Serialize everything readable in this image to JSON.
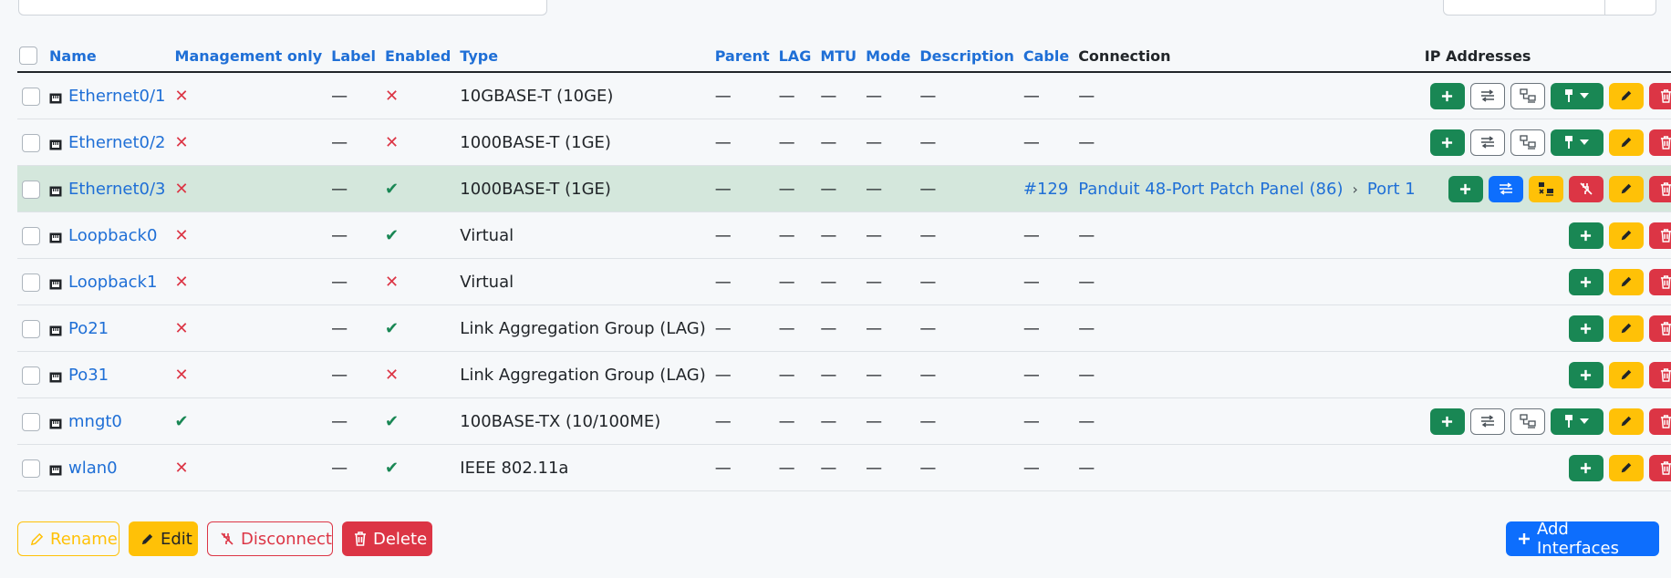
{
  "table": {
    "headers": {
      "name": "Name",
      "management_only": "Management only",
      "label": "Label",
      "enabled": "Enabled",
      "type": "Type",
      "parent": "Parent",
      "lag": "LAG",
      "mtu": "MTU",
      "mode": "Mode",
      "description": "Description",
      "cable": "Cable",
      "connection": "Connection",
      "ip_addresses": "IP Addresses"
    },
    "rows": [
      {
        "name": "Ethernet0/1",
        "mgmt": "✕",
        "label": "—",
        "enabled": "✕",
        "type": "10GBASE-T (10GE)",
        "parent": "—",
        "lag": "—",
        "mtu": "—",
        "mode": "—",
        "description": "—",
        "cable": "—",
        "connection": "—"
      },
      {
        "name": "Ethernet0/2",
        "mgmt": "✕",
        "label": "—",
        "enabled": "✕",
        "type": "1000BASE-T (1GE)",
        "parent": "—",
        "lag": "—",
        "mtu": "—",
        "mode": "—",
        "description": "—",
        "cable": "—",
        "connection": "—"
      },
      {
        "name": "Ethernet0/3",
        "mgmt": "✕",
        "label": "—",
        "enabled": "✔",
        "type": "1000BASE-T (1GE)",
        "parent": "—",
        "lag": "—",
        "mtu": "—",
        "mode": "—",
        "description": "—",
        "cable": "#129",
        "connection_device": "Panduit 48-Port Patch Panel (86)",
        "connection_port": "Port 1"
      },
      {
        "name": "Loopback0",
        "mgmt": "✕",
        "label": "—",
        "enabled": "✔",
        "type": "Virtual",
        "parent": "—",
        "lag": "—",
        "mtu": "—",
        "mode": "—",
        "description": "—",
        "cable": "—",
        "connection": "—"
      },
      {
        "name": "Loopback1",
        "mgmt": "✕",
        "label": "—",
        "enabled": "✕",
        "type": "Virtual",
        "parent": "—",
        "lag": "—",
        "mtu": "—",
        "mode": "—",
        "description": "—",
        "cable": "—",
        "connection": "—"
      },
      {
        "name": "Po21",
        "mgmt": "✕",
        "label": "—",
        "enabled": "✔",
        "type": "Link Aggregation Group (LAG)",
        "parent": "—",
        "lag": "—",
        "mtu": "—",
        "mode": "—",
        "description": "—",
        "cable": "—",
        "connection": "—"
      },
      {
        "name": "Po31",
        "mgmt": "✕",
        "label": "—",
        "enabled": "✕",
        "type": "Link Aggregation Group (LAG)",
        "parent": "—",
        "lag": "—",
        "mtu": "—",
        "mode": "—",
        "description": "—",
        "cable": "—",
        "connection": "—"
      },
      {
        "name": "mngt0",
        "mgmt": "✔",
        "label": "—",
        "enabled": "✔",
        "type": "100BASE-TX (10/100ME)",
        "parent": "—",
        "lag": "—",
        "mtu": "—",
        "mode": "—",
        "description": "—",
        "cable": "—",
        "connection": "—"
      },
      {
        "name": "wlan0",
        "mgmt": "✕",
        "label": "—",
        "enabled": "✔",
        "type": "IEEE 802.11a",
        "parent": "—",
        "lag": "—",
        "mtu": "—",
        "mode": "—",
        "description": "—",
        "cable": "—",
        "connection": "—"
      }
    ]
  },
  "bulk_actions": {
    "rename": "Rename",
    "edit": "Edit",
    "disconnect": "Disconnect",
    "delete": "Delete",
    "add_interfaces": "Add Interfaces"
  },
  "icons": {
    "interface": "ethernet-port-icon",
    "add": "plus-icon",
    "trace": "trace-icon",
    "connect_console": "connect-icon",
    "cable": "cable-icon",
    "edit": "pencil-icon",
    "delete": "trash-icon"
  },
  "colors": {
    "link": "#1f6fd6",
    "success": "#198754",
    "warning": "#ffc107",
    "danger": "#dc3545",
    "primary": "#0d6efd",
    "highlight_row": "#d4e7dc"
  }
}
